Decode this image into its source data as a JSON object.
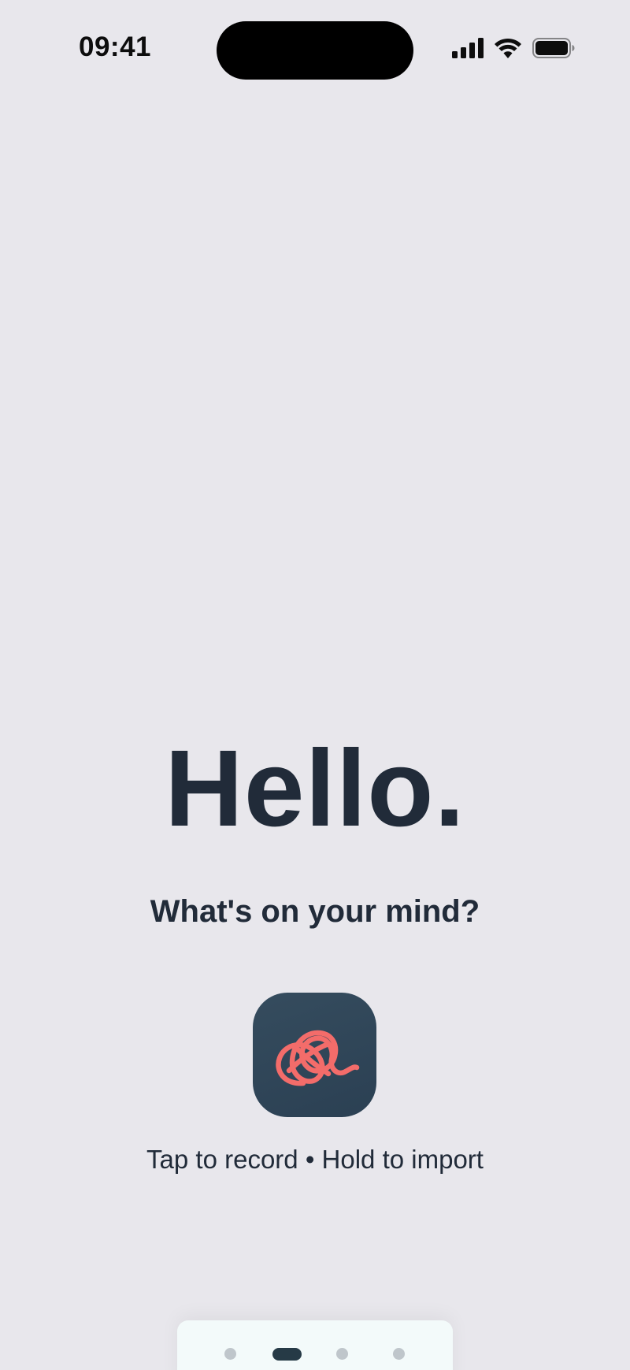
{
  "status_bar": {
    "time": "09:41",
    "icons": [
      "cellular-signal-icon",
      "wifi-icon",
      "battery-icon"
    ]
  },
  "main": {
    "title": "Hello.",
    "subtitle": "What's on your mind?",
    "record_icon": "tangled-thread-logo-icon",
    "hint": "Tap to record • Hold to import"
  },
  "pager": {
    "page_count": 4,
    "active_index": 1
  },
  "colors": {
    "background": "#e8e7ec",
    "text": "#212b39",
    "button": "#2f4557",
    "accent": "#f36c6a",
    "pager_bg": "#f3fafa",
    "dot_inactive": "#bfc6cb",
    "dot_active": "#263a46"
  }
}
